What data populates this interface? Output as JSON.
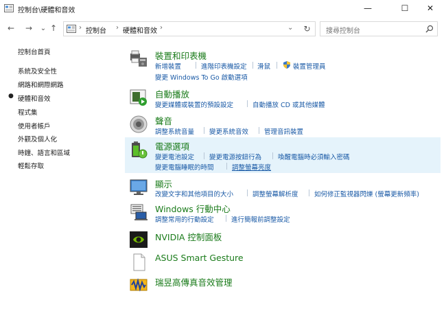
{
  "window": {
    "title": "控制台\\硬體和音效",
    "minimize": "—",
    "maximize": "☐",
    "close": "✕"
  },
  "nav": {
    "back": "←",
    "forward": "→",
    "history": "⌄",
    "up": "↑",
    "refresh": "↻",
    "breadcrumb": [
      "控制台",
      "硬體和音效"
    ],
    "search_placeholder": "搜尋控制台"
  },
  "left_nav": {
    "items": [
      {
        "label": "控制台首頁"
      },
      {
        "label": "系統及安全性"
      },
      {
        "label": "網路和網際網路"
      },
      {
        "label": "硬體和音效",
        "current": true
      },
      {
        "label": "程式集"
      },
      {
        "label": "使用者帳戶"
      },
      {
        "label": "外觀及個人化"
      },
      {
        "label": "時鐘、語言和區域"
      },
      {
        "label": "輕鬆存取"
      }
    ]
  },
  "categories": [
    {
      "title": "裝置和印表機",
      "icon": "printer-icon",
      "links": [
        "新增裝置",
        "進階印表機設定",
        "滑鼠",
        "裝置管理員",
        "變更 Windows To Go 啟動選項"
      ]
    },
    {
      "title": "自動播放",
      "icon": "autoplay-icon",
      "links": [
        "變更媒體或裝置的預設設定",
        "自動播放 CD 或其他媒體"
      ]
    },
    {
      "title": "聲音",
      "icon": "speaker-icon",
      "links": [
        "調整系統音量",
        "變更系統音效",
        "管理音訊裝置"
      ]
    },
    {
      "title": "電源選項",
      "icon": "battery-icon",
      "links": [
        "變更電池設定",
        "變更電源按鈕行為",
        "喚醒電腦時必須輸入密碼",
        "變更電腦睡眠的時間",
        "調整螢幕亮度"
      ]
    },
    {
      "title": "顯示",
      "icon": "monitor-icon",
      "links": [
        "改變文字和其他項目的大小",
        "調整螢幕解析度",
        "如何修正監視器閃爍 (螢幕更新頻率)"
      ]
    },
    {
      "title": "Windows 行動中心",
      "icon": "mobility-center-icon",
      "links": [
        "調整常用的行動設定",
        "進行簡報前調整設定"
      ]
    },
    {
      "title": "NVIDIA 控制面板",
      "icon": "nvidia-icon",
      "links": []
    },
    {
      "title": "ASUS Smart Gesture",
      "icon": "document-icon",
      "links": []
    },
    {
      "title": "瑞昱高傳真音效管理",
      "icon": "realtek-audio-icon",
      "links": []
    }
  ]
}
